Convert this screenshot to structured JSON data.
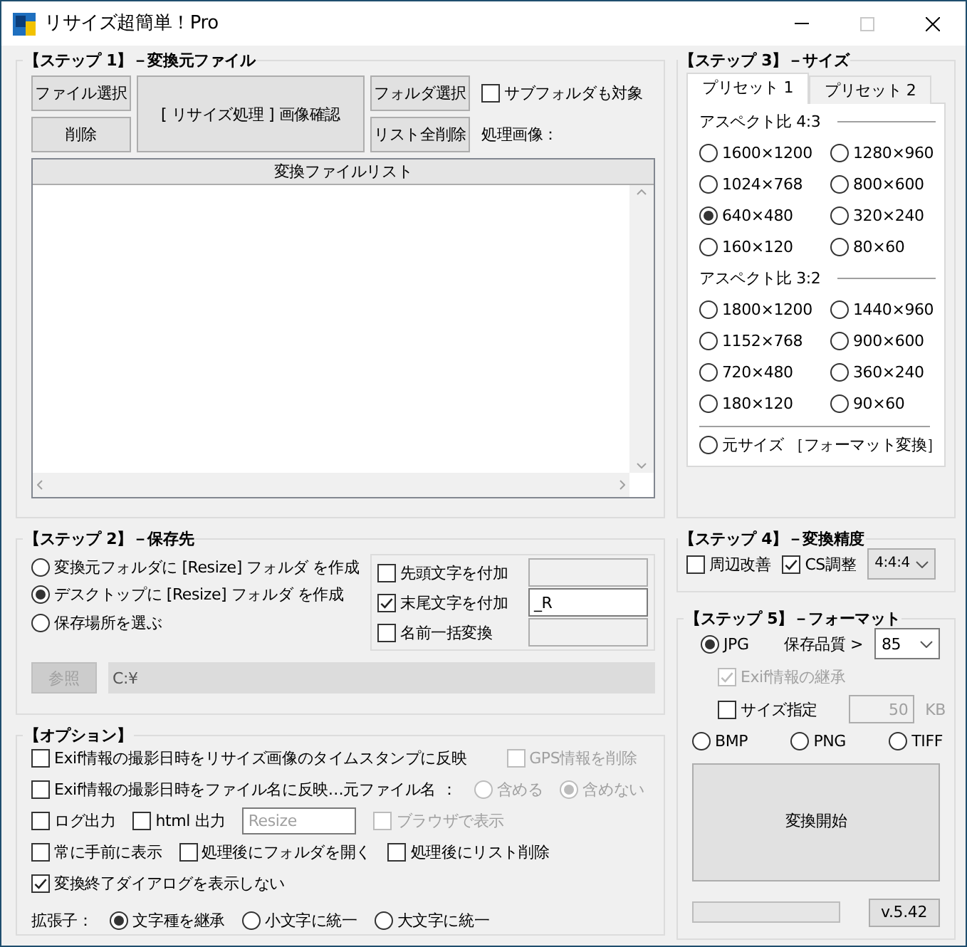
{
  "window": {
    "title": "リサイズ超簡単！Pro"
  },
  "step1": {
    "title": "【ステップ 1】－変換元ファイル",
    "buttons": [
      {
        "kind": "small",
        "label": "ファイル選択"
      },
      {
        "kind": "small",
        "label": "削除"
      },
      {
        "kind": "big",
        "label": "[ リサイズ処理 ] 画像確認"
      },
      {
        "kind": "small",
        "label": "フォルダ選択"
      },
      {
        "kind": "small",
        "label": "リスト全削除"
      }
    ],
    "subfolder": {
      "kind": "checkbox",
      "label": "サブフォルダも対象",
      "checked": false
    },
    "processing_label": "処理画像：",
    "file_list": {
      "header": "変換ファイルリスト"
    }
  },
  "step2": {
    "title": "【ステップ 2】－保存先",
    "destinations": [
      {
        "label": "変換元フォルダに [Resize] フォルダ を作成",
        "selected": false
      },
      {
        "label": "デスクトップに [Resize] フォルダ を作成",
        "selected": true
      },
      {
        "label": "保存場所を選ぶ",
        "selected": false
      }
    ],
    "name_options": [
      {
        "label": "先頭文字を付加",
        "checked": false
      },
      {
        "label": "末尾文字を付加",
        "checked": true,
        "value": "_R"
      },
      {
        "label": "名前一括変換",
        "checked": false
      }
    ],
    "browse_button": "参照",
    "path": "C:¥"
  },
  "options": {
    "title": "【オプション】",
    "lines": [
      {
        "controls": [
          {
            "kind": "checkbox",
            "label": "Exif情報の撮影日時をリサイズ画像のタイムスタンプに反映",
            "checked": false
          },
          {
            "kind": "checkbox",
            "label": "GPS情報を削除",
            "checked": false,
            "disabled": true
          }
        ]
      },
      {
        "controls": [
          {
            "kind": "checkbox",
            "label": "Exif情報の撮影日時をファイル名に反映…元ファイル名",
            "checked": false
          },
          {
            "kind": "text",
            "label": "："
          },
          {
            "kind": "radio",
            "label": "含める",
            "selected": false,
            "disabled": true
          },
          {
            "kind": "radio",
            "label": "含めない",
            "selected": true,
            "disabled": true
          }
        ]
      },
      {
        "controls": [
          {
            "kind": "checkbox",
            "label": "ログ出力",
            "checked": false
          },
          {
            "kind": "checkbox",
            "label": "html 出力",
            "checked": false
          },
          {
            "kind": "field",
            "value": "Resize",
            "disabled": true
          },
          {
            "kind": "checkbox",
            "label": "ブラウザで表示",
            "checked": false,
            "disabled": true
          }
        ]
      },
      {
        "controls": [
          {
            "kind": "checkbox",
            "label": "常に手前に表示",
            "checked": false
          },
          {
            "kind": "checkbox",
            "label": "処理後にフォルダを開く",
            "checked": false
          },
          {
            "kind": "checkbox",
            "label": "処理後にリスト削除",
            "checked": false
          }
        ]
      },
      {
        "controls": [
          {
            "kind": "checkbox",
            "label": "変換終了ダイアログを表示しない",
            "checked": true
          }
        ]
      },
      {
        "controls": [
          {
            "kind": "text",
            "label": "拡張子："
          },
          {
            "kind": "radio",
            "label": "文字種を継承",
            "selected": true
          },
          {
            "kind": "radio",
            "label": "小文字に統一",
            "selected": false
          },
          {
            "kind": "radio",
            "label": "大文字に統一",
            "selected": false
          }
        ]
      }
    ]
  },
  "step3": {
    "title": "【ステップ 3】－サイズ",
    "tabs": [
      {
        "label": "プリセット 1",
        "selected": true
      },
      {
        "label": "プリセット 2",
        "selected": false
      }
    ],
    "groups": [
      {
        "heading": "アスペクト比 4:3",
        "sizes": [
          {
            "label": "1600×1200",
            "selected": false
          },
          {
            "label": "1280×960",
            "selected": false
          },
          {
            "label": "1024×768",
            "selected": false
          },
          {
            "label": "800×600",
            "selected": false
          },
          {
            "label": "640×480",
            "selected": true
          },
          {
            "label": "320×240",
            "selected": false
          },
          {
            "label": "160×120",
            "selected": false
          },
          {
            "label": "80×60",
            "selected": false
          }
        ]
      },
      {
        "heading": "アスペクト比 3:2",
        "sizes": [
          {
            "label": "1800×1200",
            "selected": false
          },
          {
            "label": "1440×960",
            "selected": false
          },
          {
            "label": "1152×768",
            "selected": false
          },
          {
            "label": "900×600",
            "selected": false
          },
          {
            "label": "720×480",
            "selected": false
          },
          {
            "label": "360×240",
            "selected": false
          },
          {
            "label": "180×120",
            "selected": false
          },
          {
            "label": "90×60",
            "selected": false
          }
        ]
      }
    ],
    "original": {
      "label": "元サイズ ［フォーマット変換］",
      "selected": false
    }
  },
  "step4": {
    "title": "【ステップ 4】－変換精度",
    "items": [
      {
        "kind": "checkbox",
        "label": "周辺改善",
        "checked": false
      },
      {
        "kind": "checkbox",
        "label": "CS調整",
        "checked": true
      },
      {
        "kind": "select",
        "value": "4:4:4",
        "disabled": true
      }
    ]
  },
  "step5": {
    "title": "【ステップ 5】－フォーマット",
    "rows": [
      [
        {
          "kind": "radio",
          "label": "JPG",
          "selected": true
        },
        {
          "kind": "text",
          "label": "保存品質 >"
        },
        {
          "kind": "select",
          "value": "85"
        }
      ],
      [
        {
          "kind": "checkbox",
          "label": "Exif情報の継承",
          "checked": true,
          "disabled": true
        }
      ],
      [
        {
          "kind": "checkbox",
          "label": "サイズ指定",
          "checked": false
        },
        {
          "kind": "field",
          "value": "50",
          "disabled": true
        },
        {
          "kind": "text",
          "label": "KB",
          "disabled": true
        }
      ],
      [
        {
          "kind": "radio",
          "label": "BMP",
          "selected": false
        },
        {
          "kind": "radio",
          "label": "PNG",
          "selected": false
        },
        {
          "kind": "radio",
          "label": "TIFF",
          "selected": false
        }
      ]
    ],
    "start_button": "変換開始",
    "progress": {
      "level": 0
    },
    "version": "v.5.42"
  }
}
